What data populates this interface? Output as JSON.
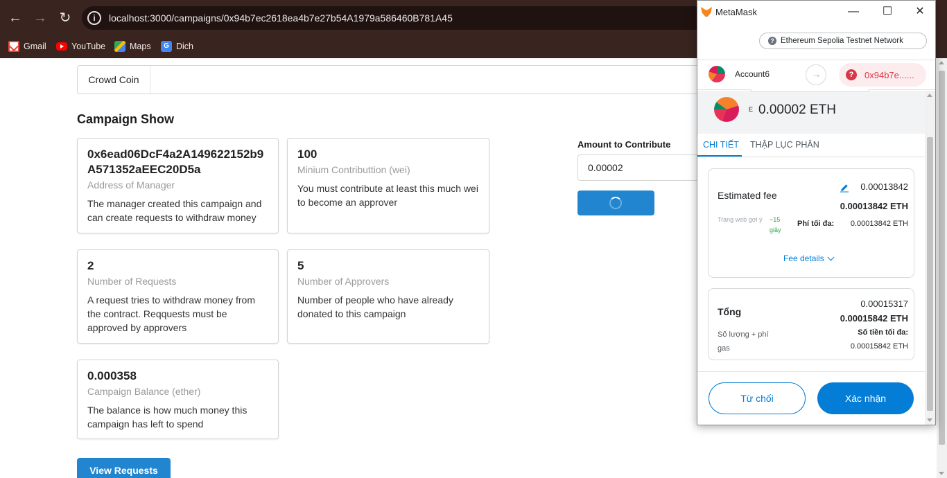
{
  "browser": {
    "url": "localhost:3000/campaigns/0x94b7ec2618ea4b7e27b54A1979a586460B781A45",
    "bookmarks": [
      {
        "label": "Gmail",
        "icon": "gmail-icon"
      },
      {
        "label": "YouTube",
        "icon": "youtube-icon"
      },
      {
        "label": "Maps",
        "icon": "maps-icon"
      },
      {
        "label": "Dich",
        "icon": "translate-icon"
      }
    ]
  },
  "app": {
    "menu_title": "Crowd Coin",
    "page_title": "Campaign Show",
    "cards": [
      {
        "header": "0x6ead06DcF4a2A149622152b9A571352aEEC20D5a",
        "meta": "Address of Manager",
        "desc": "The manager created this campaign and can create requests to withdraw money"
      },
      {
        "header": "100",
        "meta": "Minium Contributtion (wei)",
        "desc": "You must contribute at least this much wei to become an approver"
      },
      {
        "header": "2",
        "meta": "Number of Requests",
        "desc": "A request tries to withdraw money from the contract. Reqquests must be approved by approvers"
      },
      {
        "header": "5",
        "meta": "Number of Approvers",
        "desc": "Number of people who have already donated to this campaign"
      },
      {
        "header": "0.000358",
        "meta": "Campaign Balance (ether)",
        "desc": "The balance is how much money this campaign has left to spend"
      }
    ],
    "contribute": {
      "label": "Amount to Contribute",
      "value": "0.00002"
    },
    "view_requests_label": "View Requests"
  },
  "metamask": {
    "window_title": "MetaMask",
    "network": "Ethereum Sepolia Testnet Network",
    "account_name": "Account6",
    "target_address": "0x94b7e......",
    "eth_mark": "E",
    "amount": "0.00002 ETH",
    "tabs": [
      "CHI TIẾT",
      "THẬP LỤC PHÂN"
    ],
    "estimated_fee": {
      "title": "Estimated fee",
      "fiat": "0.00013842",
      "eth": "0.00013842 ETH",
      "site_hint": "Trang web gợi ý",
      "time": "~15 giây",
      "max_label": "Phí tối đa:",
      "max_value": "0.00013842 ETH",
      "details_link": "Fee details"
    },
    "total": {
      "title": "Tổng",
      "fiat": "0.00015317",
      "eth": "0.00015842 ETH",
      "sub": "Số lượng + phí gas",
      "max_label": "Số tiền tối đa:",
      "max_value": "0.00015842 ETH"
    },
    "reject_label": "Từ chối",
    "confirm_label": "Xác nhận"
  },
  "colors": {
    "chrome": "#3a2420",
    "primary_blue": "#2185d0",
    "metamask_blue": "#037dd6",
    "error_red": "#d73847"
  }
}
